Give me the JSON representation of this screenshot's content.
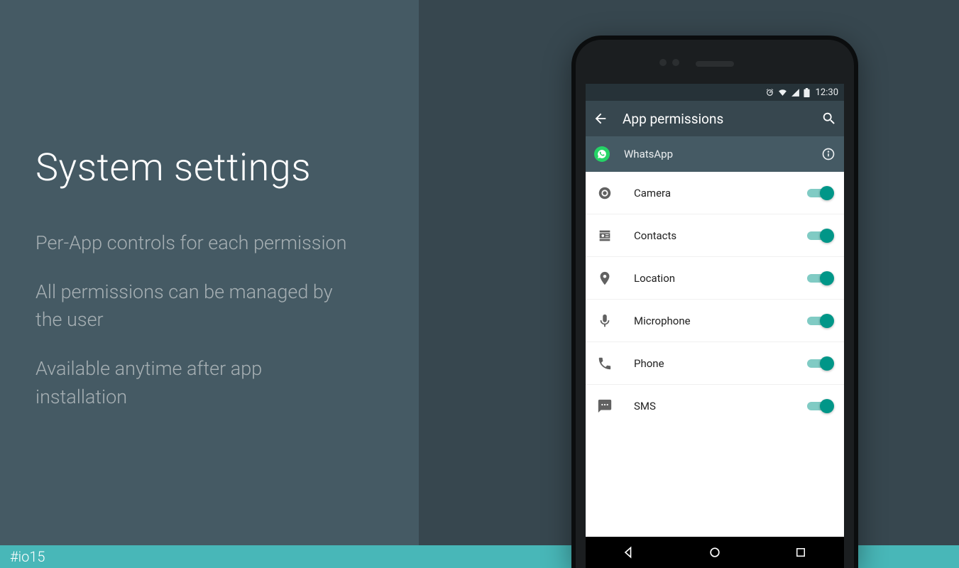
{
  "slide": {
    "title": "System settings",
    "bullets": [
      "Per-App controls for each permission",
      "All permissions can be managed by the user",
      "Available anytime after app installation"
    ]
  },
  "footer": {
    "hashtag": "#io15"
  },
  "phone": {
    "statusbar": {
      "time": "12:30"
    },
    "toolbar": {
      "title": "App permissions"
    },
    "app": {
      "name": "WhatsApp"
    },
    "permissions": [
      {
        "icon": "camera",
        "label": "Camera",
        "enabled": true
      },
      {
        "icon": "contacts",
        "label": "Contacts",
        "enabled": true
      },
      {
        "icon": "location",
        "label": "Location",
        "enabled": true
      },
      {
        "icon": "mic",
        "label": "Microphone",
        "enabled": true
      },
      {
        "icon": "phone",
        "label": "Phone",
        "enabled": true
      },
      {
        "icon": "sms",
        "label": "SMS",
        "enabled": true
      }
    ]
  },
  "colors": {
    "slide_bg_left": "#455a64",
    "slide_bg_right": "#37474f",
    "footer_bg": "#48b7b8",
    "switch_track": "#80cbc4",
    "switch_thumb": "#009688",
    "whatsapp_green": "#25d366"
  }
}
